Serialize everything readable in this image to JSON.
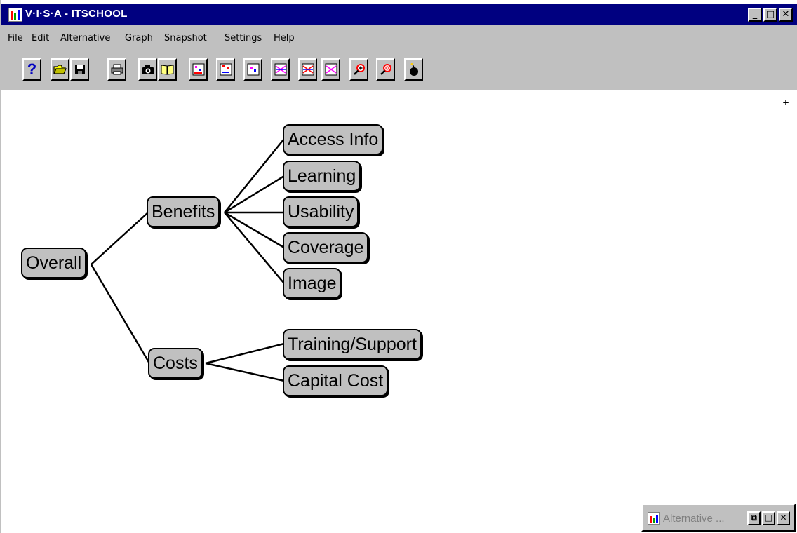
{
  "window": {
    "title": "V·I·S·A - ITSCHOOL",
    "controls": {
      "minimize": "_",
      "maximize": "□",
      "close": "✕"
    }
  },
  "menubar": {
    "items": [
      "File",
      "Edit",
      "Alternative",
      "Graph",
      "Snapshot",
      "Settings",
      "Help"
    ]
  },
  "toolbar": {
    "buttons": [
      {
        "icon": "help-icon",
        "glyph": "?"
      },
      {
        "icon": "open-folder-icon",
        "glyph": "📂"
      },
      {
        "icon": "save-disk-icon",
        "glyph": "▣"
      },
      {
        "icon": "print-icon",
        "glyph": "⎙"
      },
      {
        "icon": "camera-icon",
        "glyph": "◙"
      },
      {
        "icon": "book-icon",
        "glyph": "📖"
      },
      {
        "icon": "graph-view-1-icon",
        "glyph": "⊡"
      },
      {
        "icon": "graph-view-2-icon",
        "glyph": "⊡"
      },
      {
        "icon": "graph-view-3-icon",
        "glyph": "⊡"
      },
      {
        "icon": "chart-lines-1-icon",
        "glyph": "⊠"
      },
      {
        "icon": "chart-lines-2-icon",
        "glyph": "⊠"
      },
      {
        "icon": "chart-lines-3-icon",
        "glyph": "⊠"
      },
      {
        "icon": "zoom-in-icon",
        "glyph": "⊕"
      },
      {
        "icon": "zoom-out-icon",
        "glyph": "⊙"
      },
      {
        "icon": "bomb-icon",
        "glyph": "●"
      }
    ]
  },
  "canvas": {
    "marker": "+",
    "nodes": {
      "overall": "Overall",
      "benefits": "Benefits",
      "costs": "Costs",
      "access_info": "Access Info",
      "learning": "Learning",
      "usability": "Usability",
      "coverage": "Coverage",
      "image": "Image",
      "training_support": "Training/Support",
      "capital_cost": "Capital Cost"
    }
  },
  "minimized_window": {
    "title": "Alternative ...",
    "controls": {
      "restore": "⧉",
      "maximize": "□",
      "close": "✕"
    }
  },
  "colors": {
    "titlebar": "#000080",
    "chrome": "#c0c0c0",
    "node_fill": "#c0c0c0",
    "canvas": "#ffffff"
  }
}
